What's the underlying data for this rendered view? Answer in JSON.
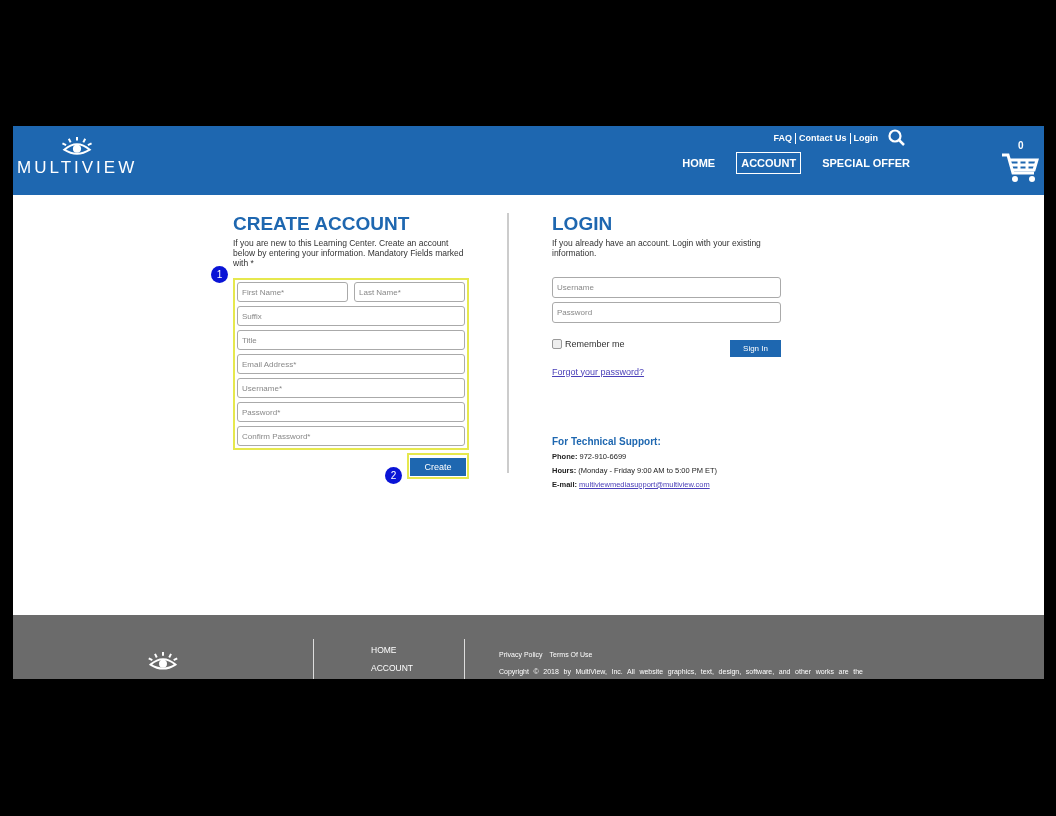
{
  "header": {
    "logo": "MULTIVIEW",
    "top_links": [
      "FAQ",
      "Contact Us",
      "Login"
    ],
    "nav": [
      {
        "label": "HOME",
        "selected": false
      },
      {
        "label": "ACCOUNT",
        "selected": true
      },
      {
        "label": "SPECIAL OFFER",
        "selected": false
      }
    ],
    "cart_count": "0"
  },
  "create_account": {
    "title": "CREATE ACCOUNT",
    "intro": "If you are new to this Learning Center. Create an account below by entering your information. Mandatory Fields marked with *",
    "step_fields": "1",
    "name_fields": [
      {
        "placeholder": "First Name*"
      },
      {
        "placeholder": "Last Name*"
      }
    ],
    "fields": [
      {
        "placeholder": "Suffix"
      },
      {
        "placeholder": "Title"
      },
      {
        "placeholder": "Email Address*"
      },
      {
        "placeholder": "Username*"
      },
      {
        "placeholder": "Password*"
      },
      {
        "placeholder": "Confirm Password*"
      }
    ],
    "step_button": "2",
    "button": "Create"
  },
  "login": {
    "title": "LOGIN",
    "intro": "If you already have an account. Login with your existing information.",
    "fields": [
      {
        "placeholder": "Username"
      },
      {
        "placeholder": "Password"
      }
    ],
    "remember": {
      "label": "Remember me",
      "checked": false
    },
    "button": "Sign In",
    "forgot": "Forgot your password?"
  },
  "support": {
    "title": "For Technical Support:",
    "lines": [
      {
        "label": "Phone:",
        "value": "972-910-6699"
      },
      {
        "label": "Hours:",
        "value": "(Monday - Friday 9:00 AM to 5:00 PM ET)"
      },
      {
        "label": "E-mail:",
        "value": "multiviewmediasupport@multiview.com",
        "link": true
      }
    ]
  },
  "footer": {
    "nav": [
      "HOME",
      "ACCOUNT"
    ],
    "links": [
      "Privacy Policy",
      "Terms Of Use"
    ],
    "copyright": "Copyright © 2018 by MultiView, Inc. All website graphics, text, design, software, and other works are the"
  }
}
